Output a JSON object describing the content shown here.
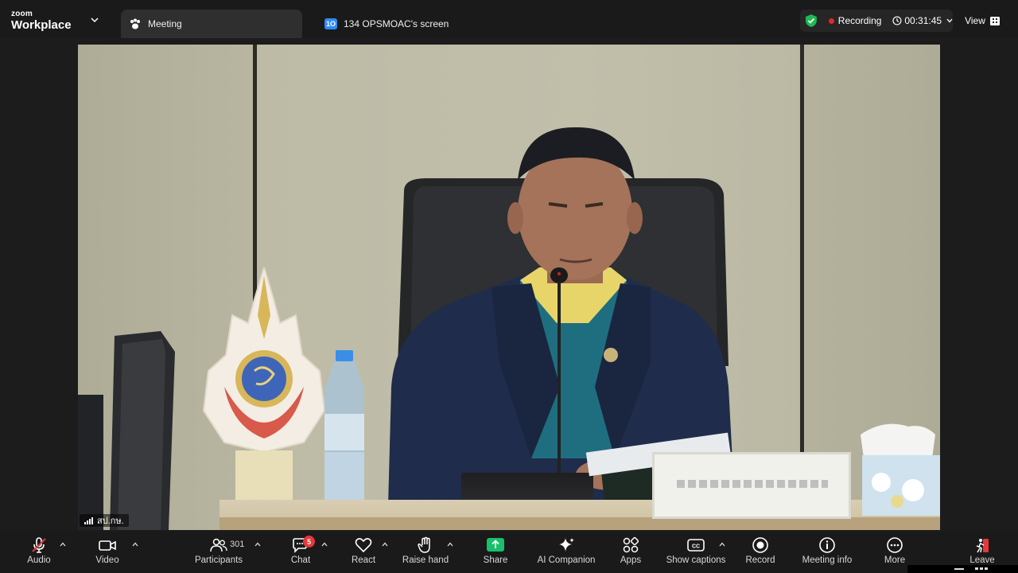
{
  "app": {
    "brand_top": "zoom",
    "brand_name": "Workplace"
  },
  "tabs": [
    {
      "label": "Meeting",
      "icon": "paw-icon",
      "active": true
    },
    {
      "label": "134 OPSMOAC's screen",
      "icon": "screen-share-icon",
      "badge": "1O"
    }
  ],
  "status": {
    "shield_icon": "shield-check-icon",
    "recording_label": "Recording",
    "timer": "00:31:45",
    "view_label": "View"
  },
  "video": {
    "participant_label": "สป.กษ."
  },
  "toolbar": {
    "audio": "Audio",
    "video": "Video",
    "participants": "Participants",
    "participants_count": "301",
    "chat": "Chat",
    "chat_badge": "5",
    "react": "React",
    "raise_hand": "Raise hand",
    "share": "Share",
    "ai_companion": "AI Companion",
    "apps": "Apps",
    "show_captions": "Show captions",
    "record": "Record",
    "meeting_info": "Meeting info",
    "more": "More",
    "leave": "Leave"
  },
  "colors": {
    "share_green": "#16c16a",
    "recording_red": "#e02828",
    "badge_red": "#e5383b",
    "shield_green": "#1db954",
    "zoom_blue": "#2d8cff"
  }
}
